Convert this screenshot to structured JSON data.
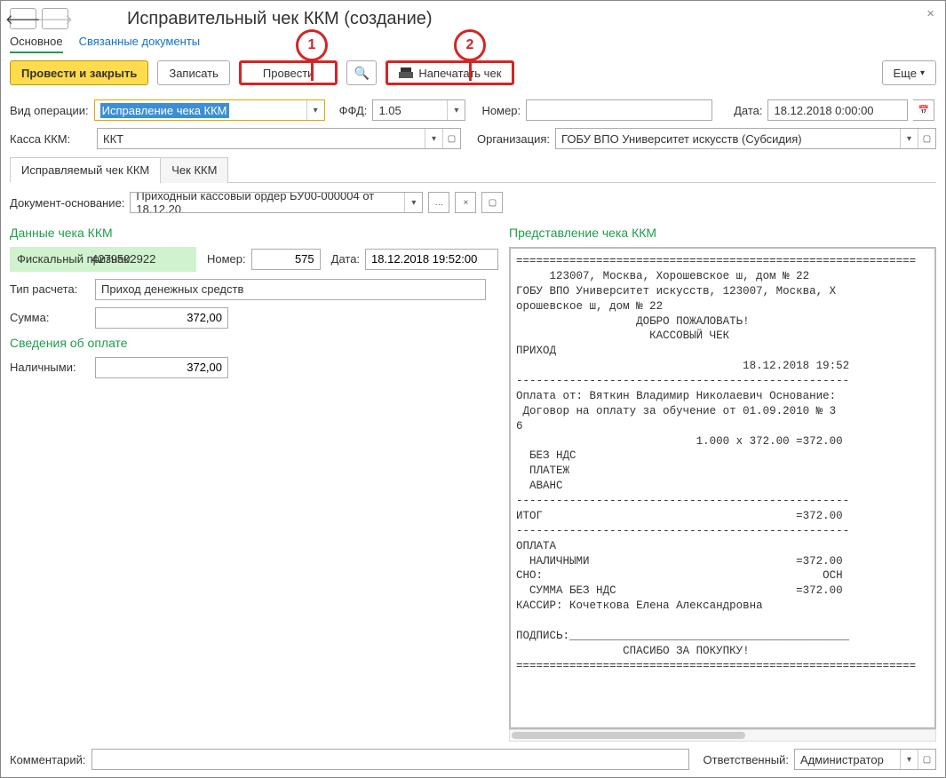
{
  "window": {
    "title": "Исправительный чек ККМ (создание)"
  },
  "callouts": {
    "one": "1",
    "two": "2"
  },
  "nav_tabs": {
    "main": "Основное",
    "linked": "Связанные документы"
  },
  "toolbar": {
    "post_close": "Провести и закрыть",
    "save": "Записать",
    "post": "Провести",
    "print_check": "Напечатать чек",
    "more": "Еще"
  },
  "fields": {
    "op_type_label": "Вид операции:",
    "op_type_value": "Исправление чека ККМ",
    "ffd_label": "ФФД:",
    "ffd_value": "1.05",
    "number_label": "Номер:",
    "number_value": "",
    "date_label": "Дата:",
    "date_value": "18.12.2018  0:00:00",
    "kassa_label": "Касса ККМ:",
    "kassa_value": "ККТ",
    "org_label": "Организация:",
    "org_value": "ГОБУ ВПО Университет искусств (Субсидия)"
  },
  "sub_tabs": {
    "t1": "Исправляемый чек ККМ",
    "t2": "Чек ККМ"
  },
  "doc_basis": {
    "label": "Документ-основание:",
    "value": "Приходный кассовый ордер БУ00-000004 от 18.12.20"
  },
  "left": {
    "section1": "Данные чека ККМ",
    "fp_label": "Фискальный признак:",
    "fp_value": "4279502922",
    "num_label": "Номер:",
    "num_value": "575",
    "dt_label": "Дата:",
    "dt_value": "18.12.2018 19:52:00",
    "calc_label": "Тип расчета:",
    "calc_value": "Приход денежных средств",
    "sum_label": "Сумма:",
    "sum_value": "372,00",
    "section2": "Сведения об оплате",
    "cash_label": "Наличными:",
    "cash_value": "372,00"
  },
  "right": {
    "section": "Представление чека ККМ",
    "receipt": "============================================================\n     123007, Москва, Хорошевское ш, дом № 22\nГОБУ ВПО Университет искусств, 123007, Москва, Х\nорошевское ш, дом № 22\n                  ДОБРО ПОЖАЛОВАТЬ!\n                    КАССОВЫЙ ЧЕК\nПРИХОД\n                                  18.12.2018 19:52\n--------------------------------------------------\nОплата от: Вяткин Владимир Николаевич Основание:\n Договор на оплату за обучение от 01.09.2010 № 3\n6\n                           1.000 x 372.00 =372.00\n  БЕЗ НДС\n  ПЛАТЕЖ\n  АВАНС\n--------------------------------------------------\nИТОГ                                      =372.00\n--------------------------------------------------\nОПЛАТА\n  НАЛИЧНЫМИ                               =372.00\nСНО:                                          ОСН\n  СУММА БЕЗ НДС                           =372.00\nКАССИР: Кочеткова Елена Александровна\n\nПОДПИСЬ:__________________________________________\n                СПАСИБО ЗА ПОКУПКУ!\n============================================================"
  },
  "bottom": {
    "comment_label": "Комментарий:",
    "comment_value": "",
    "resp_label": "Ответственный:",
    "resp_value": "Администратор"
  }
}
